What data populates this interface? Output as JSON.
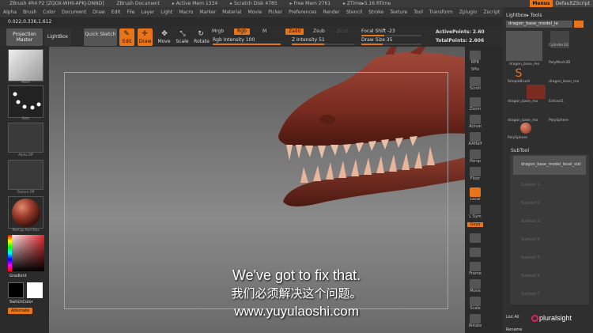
{
  "titlebar": {
    "items": [
      "ZBrush 4R4 P2 [ZQOX-WHII-APKJ-DNND]",
      "ZBrush Document",
      "▸ Active Mem 1334",
      "▸ Scratch Disk 4785",
      "▸ Free Mem 2761",
      "▸ ZTime▸5.16 RTime"
    ],
    "menus_label": "Menus",
    "default_label": "DefaultZScript"
  },
  "menubar": [
    "Alpha",
    "Brush",
    "Color",
    "Document",
    "Draw",
    "Edit",
    "File",
    "Layer",
    "Light",
    "Macro",
    "Marker",
    "Material",
    "Movie",
    "Picker",
    "Preferences",
    "Render",
    "Stencil",
    "Stroke",
    "Texture",
    "Tool",
    "Transform",
    "Zplugin",
    "Zscript"
  ],
  "coords": "0.022,0.336,1.612",
  "toolbar": {
    "projection_master": "Projection Master",
    "lightbox": "LightBox",
    "quick_sketch": "Quick Sketch",
    "edit": "Edit",
    "draw": "Draw",
    "move": "Move",
    "scale": "Scale",
    "rotate": "Rotate",
    "mrgb": "Mrgb",
    "rgb": "Rgb",
    "m": "M",
    "zadd": "Zadd",
    "zsub": "Zsub",
    "zcut": "Zcut",
    "rgb_intensity": "Rgb Intensity 100",
    "z_intensity": "Z Intensity 51",
    "focal_shift": "Focal Shift -23",
    "draw_size": "Draw Size 35",
    "active_points": "ActivePoints: 2.60",
    "total_points": "TotalPoints: 2.606",
    "rgb_intensity_value": 1.0,
    "z_intensity_value": 0.51,
    "focal_shift_value": 0.38,
    "draw_size_value": 0.35
  },
  "leftpanel": {
    "brush_label": "Move",
    "stroke_label": "Dots",
    "alpha_label": "Alpha Off",
    "texture_label": "Texture Off",
    "material_label": "MatCap Red Wax",
    "gradient_label": "Gradient",
    "switch_color_label": "SwitchColor",
    "alternate_label": "Alternate"
  },
  "rightbar": [
    "BPR",
    "SPix",
    "Scroll",
    "Zoom",
    "Actual",
    "AAHalf",
    "Persp",
    "Floor",
    "Local",
    "L.Sym",
    "Gxyz",
    "",
    "",
    "Frame",
    "Move",
    "Scale",
    "Rotate"
  ],
  "rpanel": {
    "title": "Lightbox▸ Tools",
    "selected_tool": "dragon_base_model_le",
    "tools": [
      {
        "label": "dragon_base_mo"
      },
      {
        "label": "Cylinder3D"
      },
      {
        "label": "PolyMesh3D"
      },
      {
        "label": "SimpleBrush"
      },
      {
        "label": "dragon_base_mo"
      },
      {
        "label": "dragon_base_mo"
      },
      {
        "label": "Extract1"
      },
      {
        "label": "dragon_base_mo"
      },
      {
        "label": "PolySphere"
      },
      {
        "label": "PolySphere"
      }
    ],
    "subtool_title": "SubTool",
    "subtools": [
      "dragon_base_model_level_sixt",
      "Subtool 1",
      "Subtool 2",
      "Subtool 3",
      "Subtool 4",
      "Subtool 5",
      "Subtool 6",
      "Subtool 7"
    ],
    "list_all": "List All",
    "rename": "Rename"
  },
  "subtitles": {
    "en": "We've got to fix that.",
    "zh": "我们必须解决这个问题。",
    "url": "www.yuyulaoshi.com"
  },
  "watermark": "pluralsight",
  "colors": {
    "accent": "#e8751a",
    "dragon": "#8b3a2a"
  }
}
